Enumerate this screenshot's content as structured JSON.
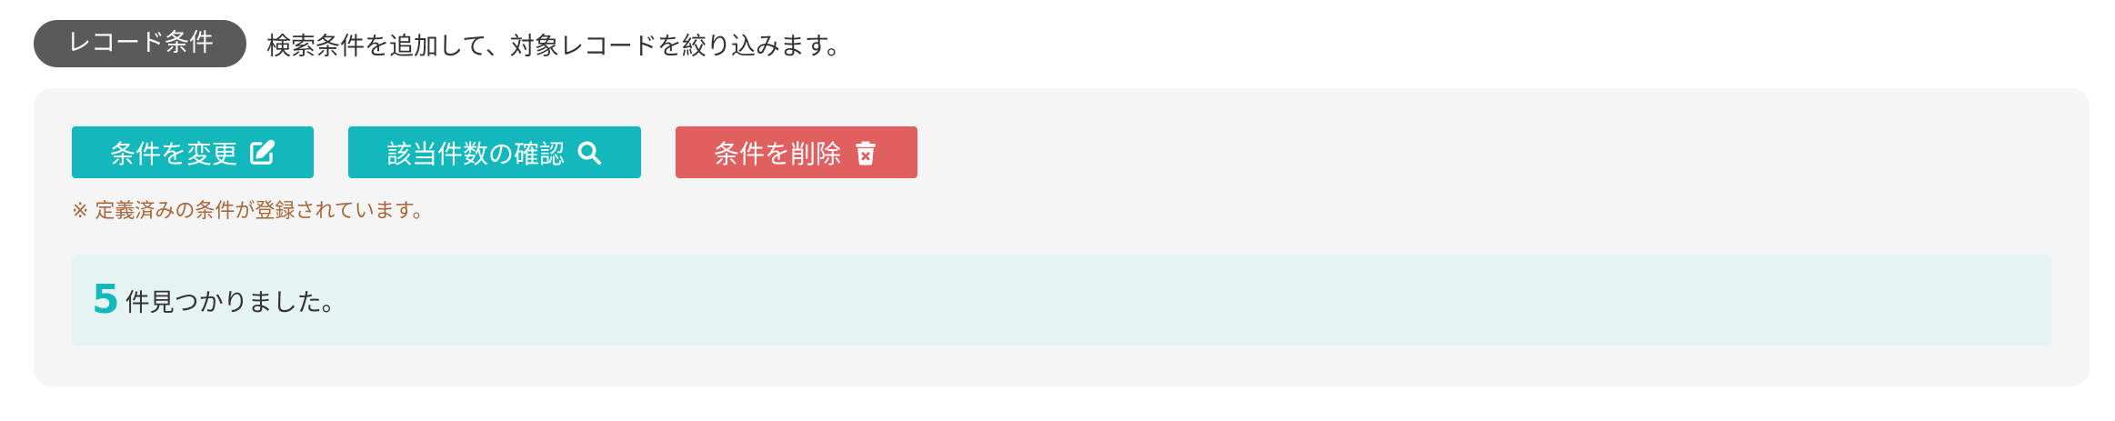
{
  "header": {
    "badge_label": "レコード条件",
    "description": "検索条件を追加して、対象レコードを絞り込みます。"
  },
  "toolbar": {
    "change_label": "条件を変更",
    "count_label": "該当件数の確認",
    "delete_label": "条件を削除"
  },
  "note": "※ 定義済みの条件が登録されています。",
  "result": {
    "count": "5",
    "text": "件見つかりました。"
  },
  "colors": {
    "teal": "#12b8bb",
    "red": "#e06060",
    "badge": "#5a5a5a",
    "note": "#a9663a",
    "result_bg": "#e6f3f3",
    "panel_bg": "#f5f5f5"
  },
  "icons": {
    "change": "edit-icon",
    "count": "search-icon",
    "delete": "trash-icon"
  }
}
